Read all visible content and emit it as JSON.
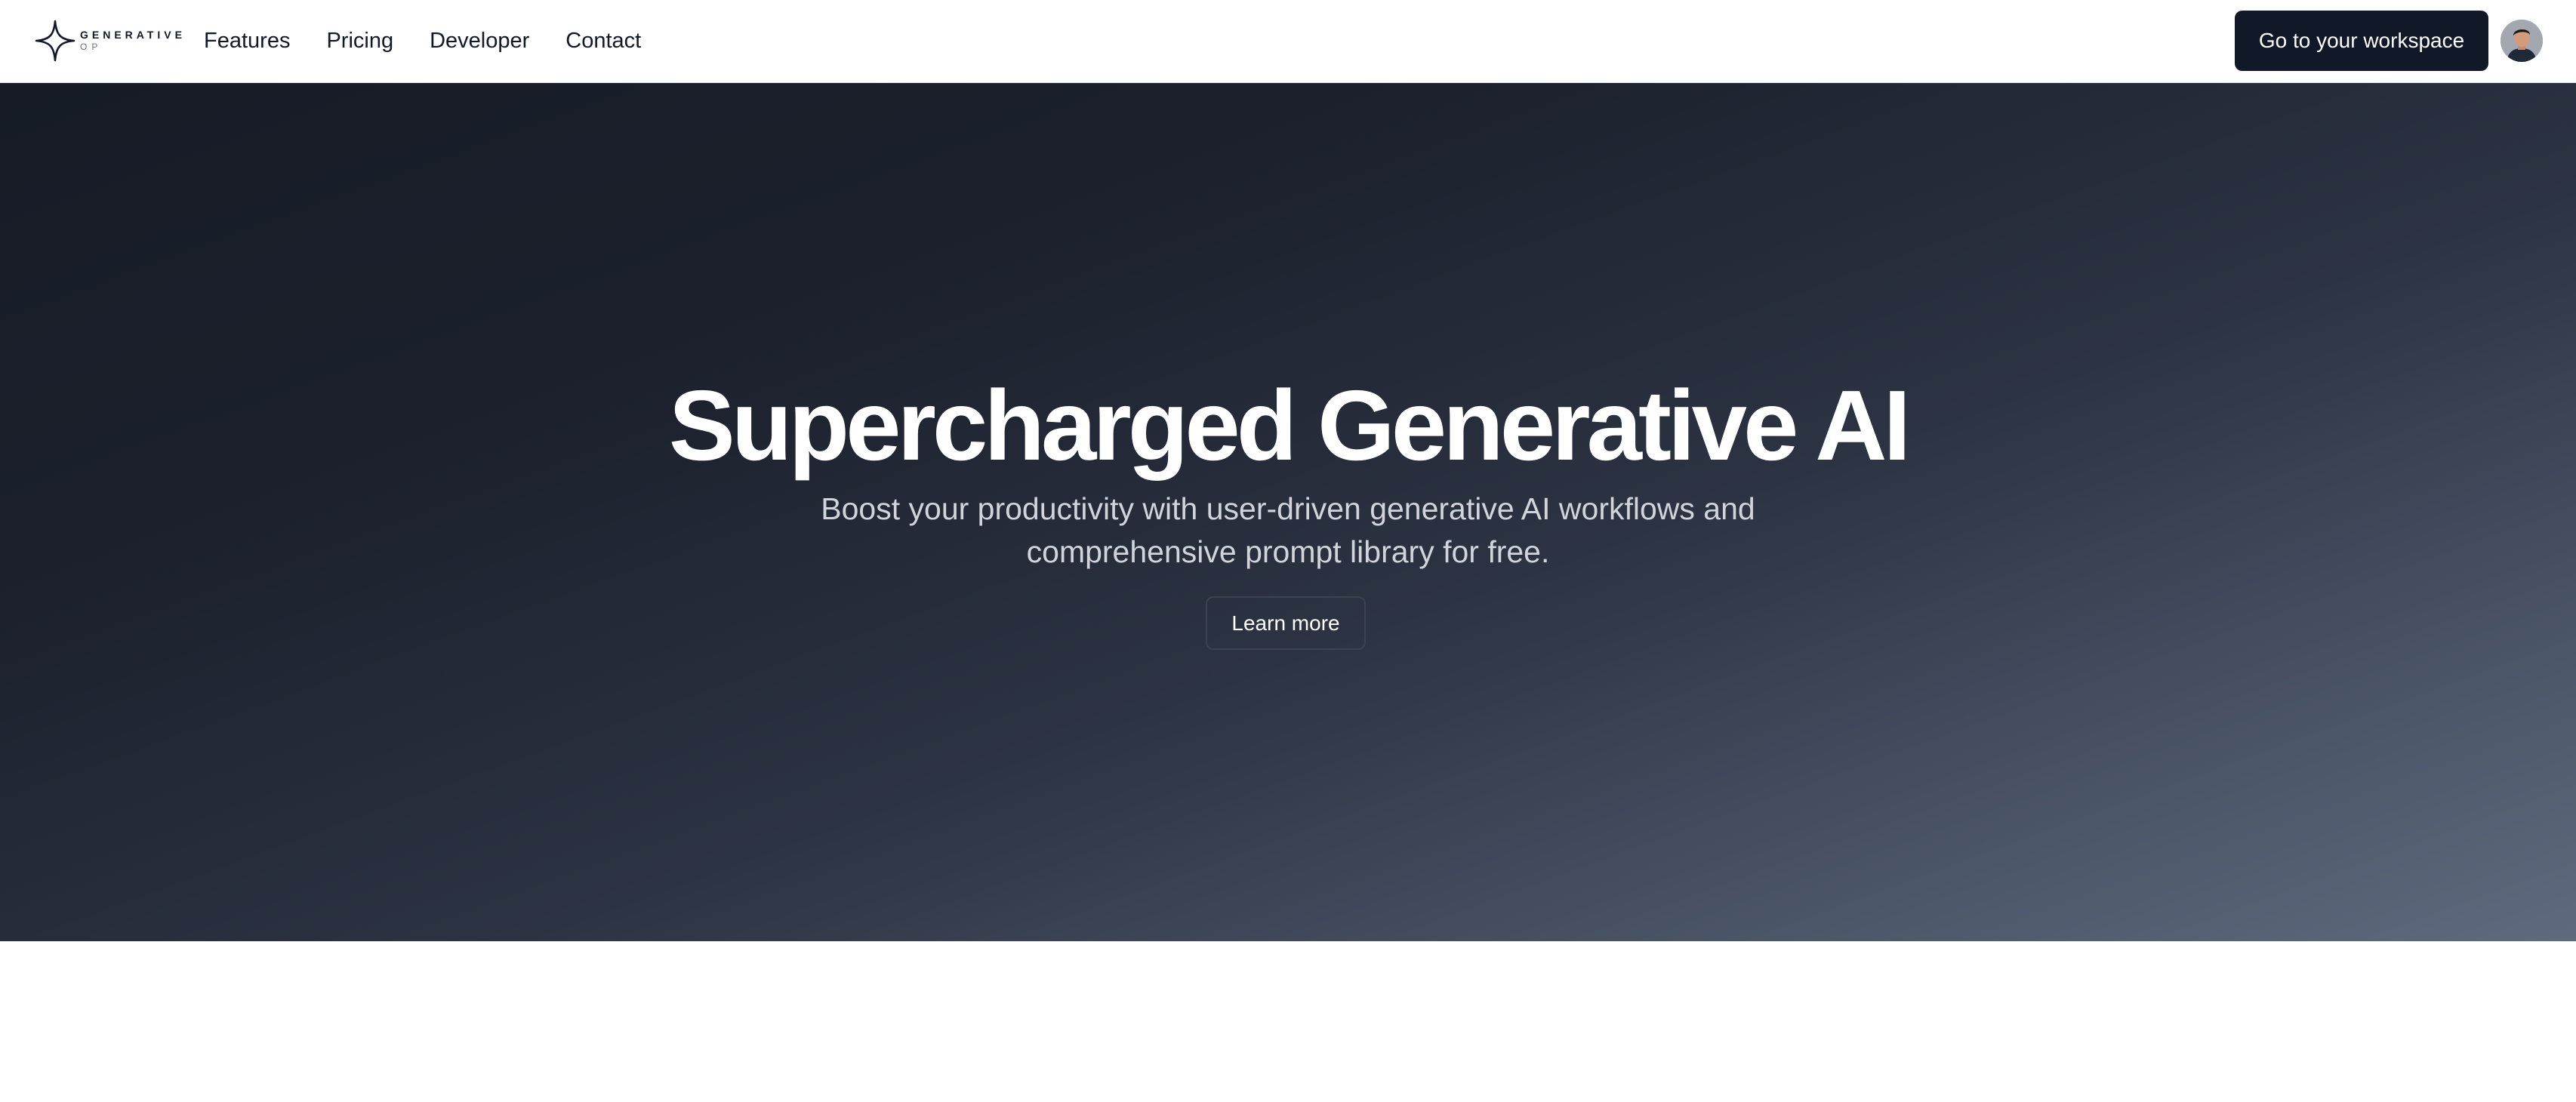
{
  "brand": {
    "name_line1": "GENERATIVE",
    "name_line2": "OP",
    "logo_icon": "four-point-star-icon"
  },
  "nav": {
    "links": [
      {
        "label": "Features"
      },
      {
        "label": "Pricing"
      },
      {
        "label": "Developer"
      },
      {
        "label": "Contact"
      }
    ],
    "workspace_button_label": "Go to your workspace",
    "avatar_icon": "user-avatar"
  },
  "hero": {
    "title": "Supercharged Generative AI",
    "subtitle": "Boost your productivity with user-driven generative AI workflows and comprehensive prompt library for free.",
    "cta_label": "Learn more"
  },
  "colors": {
    "primary_button": "#111827",
    "hero_gradient_start": "#161b26",
    "hero_gradient_end": "#5f6a7e",
    "hero_title": "#ffffff",
    "hero_subtitle": "#d1d5db"
  }
}
